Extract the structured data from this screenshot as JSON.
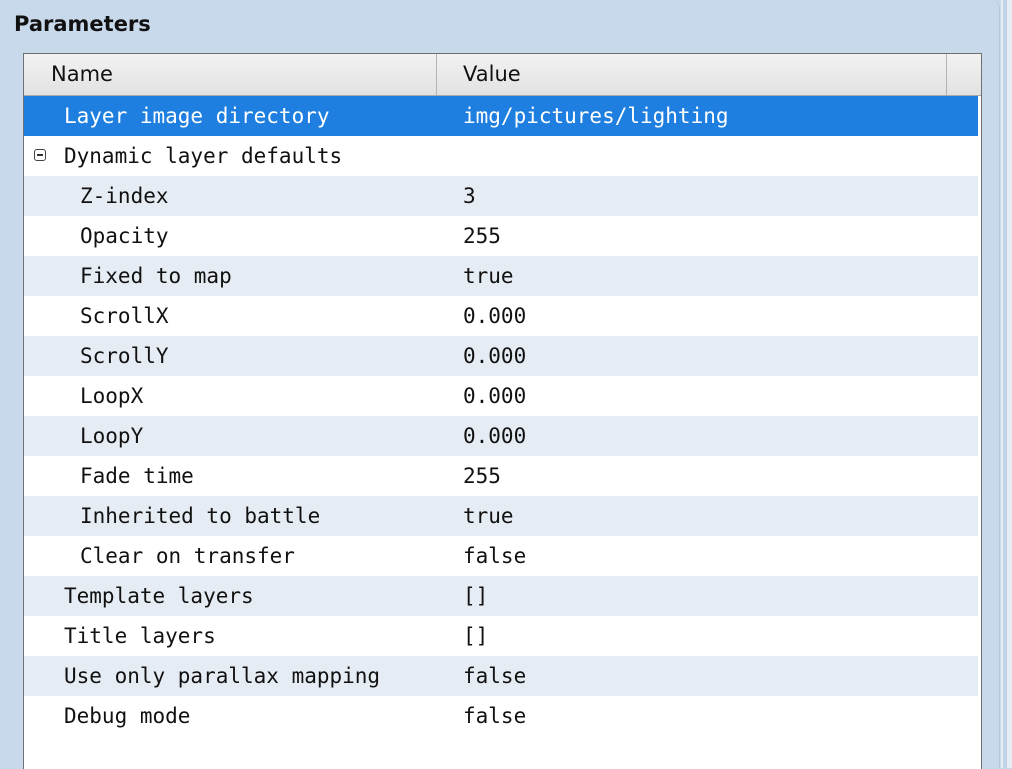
{
  "panel": {
    "title": "Parameters"
  },
  "table": {
    "columns": [
      "Name",
      "Value"
    ],
    "rows": [
      {
        "name": "Layer image directory",
        "value": "img/pictures/lighting",
        "level": 0,
        "selected": true
      },
      {
        "name": "Dynamic layer defaults",
        "value": "",
        "level": 0,
        "group": true,
        "expanded": true
      },
      {
        "name": "Z-index",
        "value": "3",
        "level": 1
      },
      {
        "name": "Opacity",
        "value": "255",
        "level": 1
      },
      {
        "name": "Fixed to map",
        "value": "true",
        "level": 1
      },
      {
        "name": "ScrollX",
        "value": "0.000",
        "level": 1
      },
      {
        "name": "ScrollY",
        "value": "0.000",
        "level": 1
      },
      {
        "name": "LoopX",
        "value": "0.000",
        "level": 1
      },
      {
        "name": "LoopY",
        "value": "0.000",
        "level": 1
      },
      {
        "name": "Fade time",
        "value": "255",
        "level": 1
      },
      {
        "name": "Inherited to battle",
        "value": "true",
        "level": 1
      },
      {
        "name": "Clear on transfer",
        "value": "false",
        "level": 1
      },
      {
        "name": "Template layers",
        "value": "[]",
        "level": 0
      },
      {
        "name": "Title layers",
        "value": "[]",
        "level": 0
      },
      {
        "name": "Use only parallax mapping",
        "value": "false",
        "level": 0
      },
      {
        "name": "Debug mode",
        "value": "false",
        "level": 0
      }
    ]
  },
  "icons": {
    "group_toggle": "collapse-minus-icon"
  },
  "colors": {
    "selection": "#1e7fe0",
    "alt_row": "#e6ecf3",
    "panel_bg": "#c9d9ec"
  }
}
